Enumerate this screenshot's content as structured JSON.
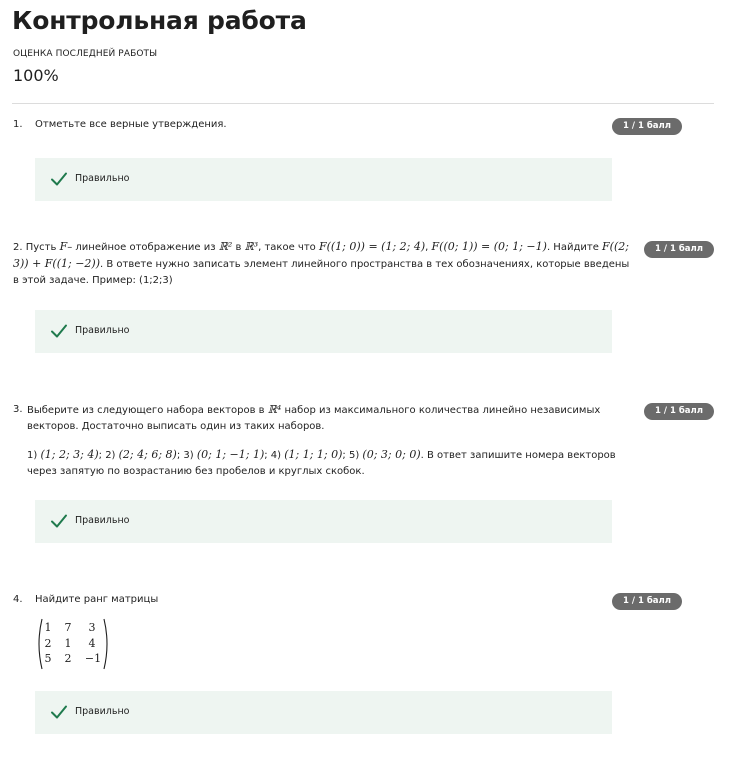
{
  "page": {
    "title": "Контрольная работа",
    "grade_label": "ОЦЕНКА ПОСЛЕДНЕЙ РАБОТЫ",
    "grade_value": "100%"
  },
  "feedback_label": "Правильно",
  "colors": {
    "badge_bg": "#6b6b6b",
    "feedback_bg": "#eef5f1",
    "check": "#1f7a4d"
  },
  "questions": [
    {
      "number": "1.",
      "score": "1 / 1 балл",
      "text": "Отметьте все верные утверждения."
    },
    {
      "number": "2.",
      "score": "1 / 1 балл",
      "parts": {
        "p1": "Пусть",
        "m1": "F",
        "p2": "– линейное отображение из",
        "m2": "ℝ²",
        "p3": "в",
        "m3": "ℝ³",
        "p4": ", такое что",
        "m4": "F((1; 0)) = (1; 2; 4)",
        "p5": ",",
        "m5": "F((0; 1)) = (0; 1; −1)",
        "p6": ". Найдите",
        "m6": "F((2; 3)) + F((1; −2))",
        "p7": ". В ответе нужно записать элемент линейного пространства в тех обозначениях, которые введены в этой задаче. Пример: (1;2;3)"
      }
    },
    {
      "number": "3.",
      "score": "1 / 1 балл",
      "parts": {
        "p1": "Выберите из следующего набора векторов в",
        "m1": "ℝ⁴",
        "p2": "набор из максимального количества линейно независимых векторов. Достаточно выписать один из таких наборов.",
        "p3": "1)",
        "m3": "(1; 2; 3; 4)",
        "p4": "; 2)",
        "m4": "(2; 4; 6; 8)",
        "p5": "; 3)",
        "m5": "(0; 1; −1; 1)",
        "p6": "; 4)",
        "m6": "(1; 1; 1; 0)",
        "p7": "; 5)",
        "m7": "(0; 3; 0; 0)",
        "p8": ". В ответ запишите номера векторов через запятую по возрастанию без пробелов и круглых скобок."
      }
    },
    {
      "number": "4.",
      "score": "1 / 1 балл",
      "text": "Найдите ранг матрицы",
      "matrix": [
        [
          "1",
          "7",
          "3"
        ],
        [
          "2",
          "1",
          "4"
        ],
        [
          "5",
          "2",
          "−1"
        ]
      ]
    }
  ]
}
